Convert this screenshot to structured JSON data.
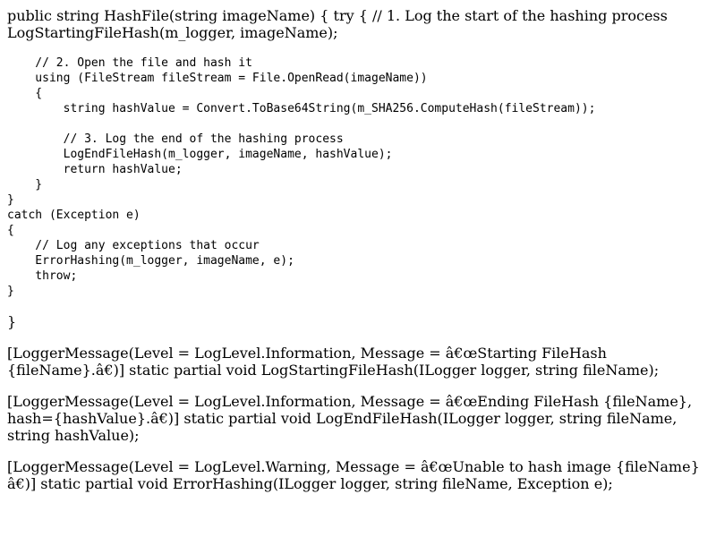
{
  "document": {
    "intro_text": "public string HashFile(string imageName) { try { // 1. Log the start of the hashing process LogStartingFileHash(m_logger, imageName);",
    "code_block": "    // 2. Open the file and hash it\n    using (FileStream fileStream = File.OpenRead(imageName))\n    {\n        string hashValue = Convert.ToBase64String(m_SHA256.ComputeHash(fileStream));\n\n        // 3. Log the end of the hashing process\n        LogEndFileHash(m_logger, imageName, hashValue);\n        return hashValue;\n    }\n}\ncatch (Exception e)\n{\n    // Log any exceptions that occur\n    ErrorHashing(m_logger, imageName, e);\n    throw;\n}",
    "closing_brace": "}",
    "logger_paragraphs": [
      "[LoggerMessage(Level = LogLevel.Information, Message = â€œStarting FileHash {fileName}.â€)] static partial void LogStartingFileHash(ILogger logger, string fileName);",
      "[LoggerMessage(Level = LogLevel.Information, Message = â€œEnding FileHash {fileName}, hash={hashValue}.â€)] static partial void LogEndFileHash(ILogger logger, string fileName, string hashValue);",
      "[LoggerMessage(Level = LogLevel.Warning, Message = â€œUnable to hash image {fileName} â€)] static partial void ErrorHashing(ILogger logger, string fileName, Exception e);"
    ]
  }
}
